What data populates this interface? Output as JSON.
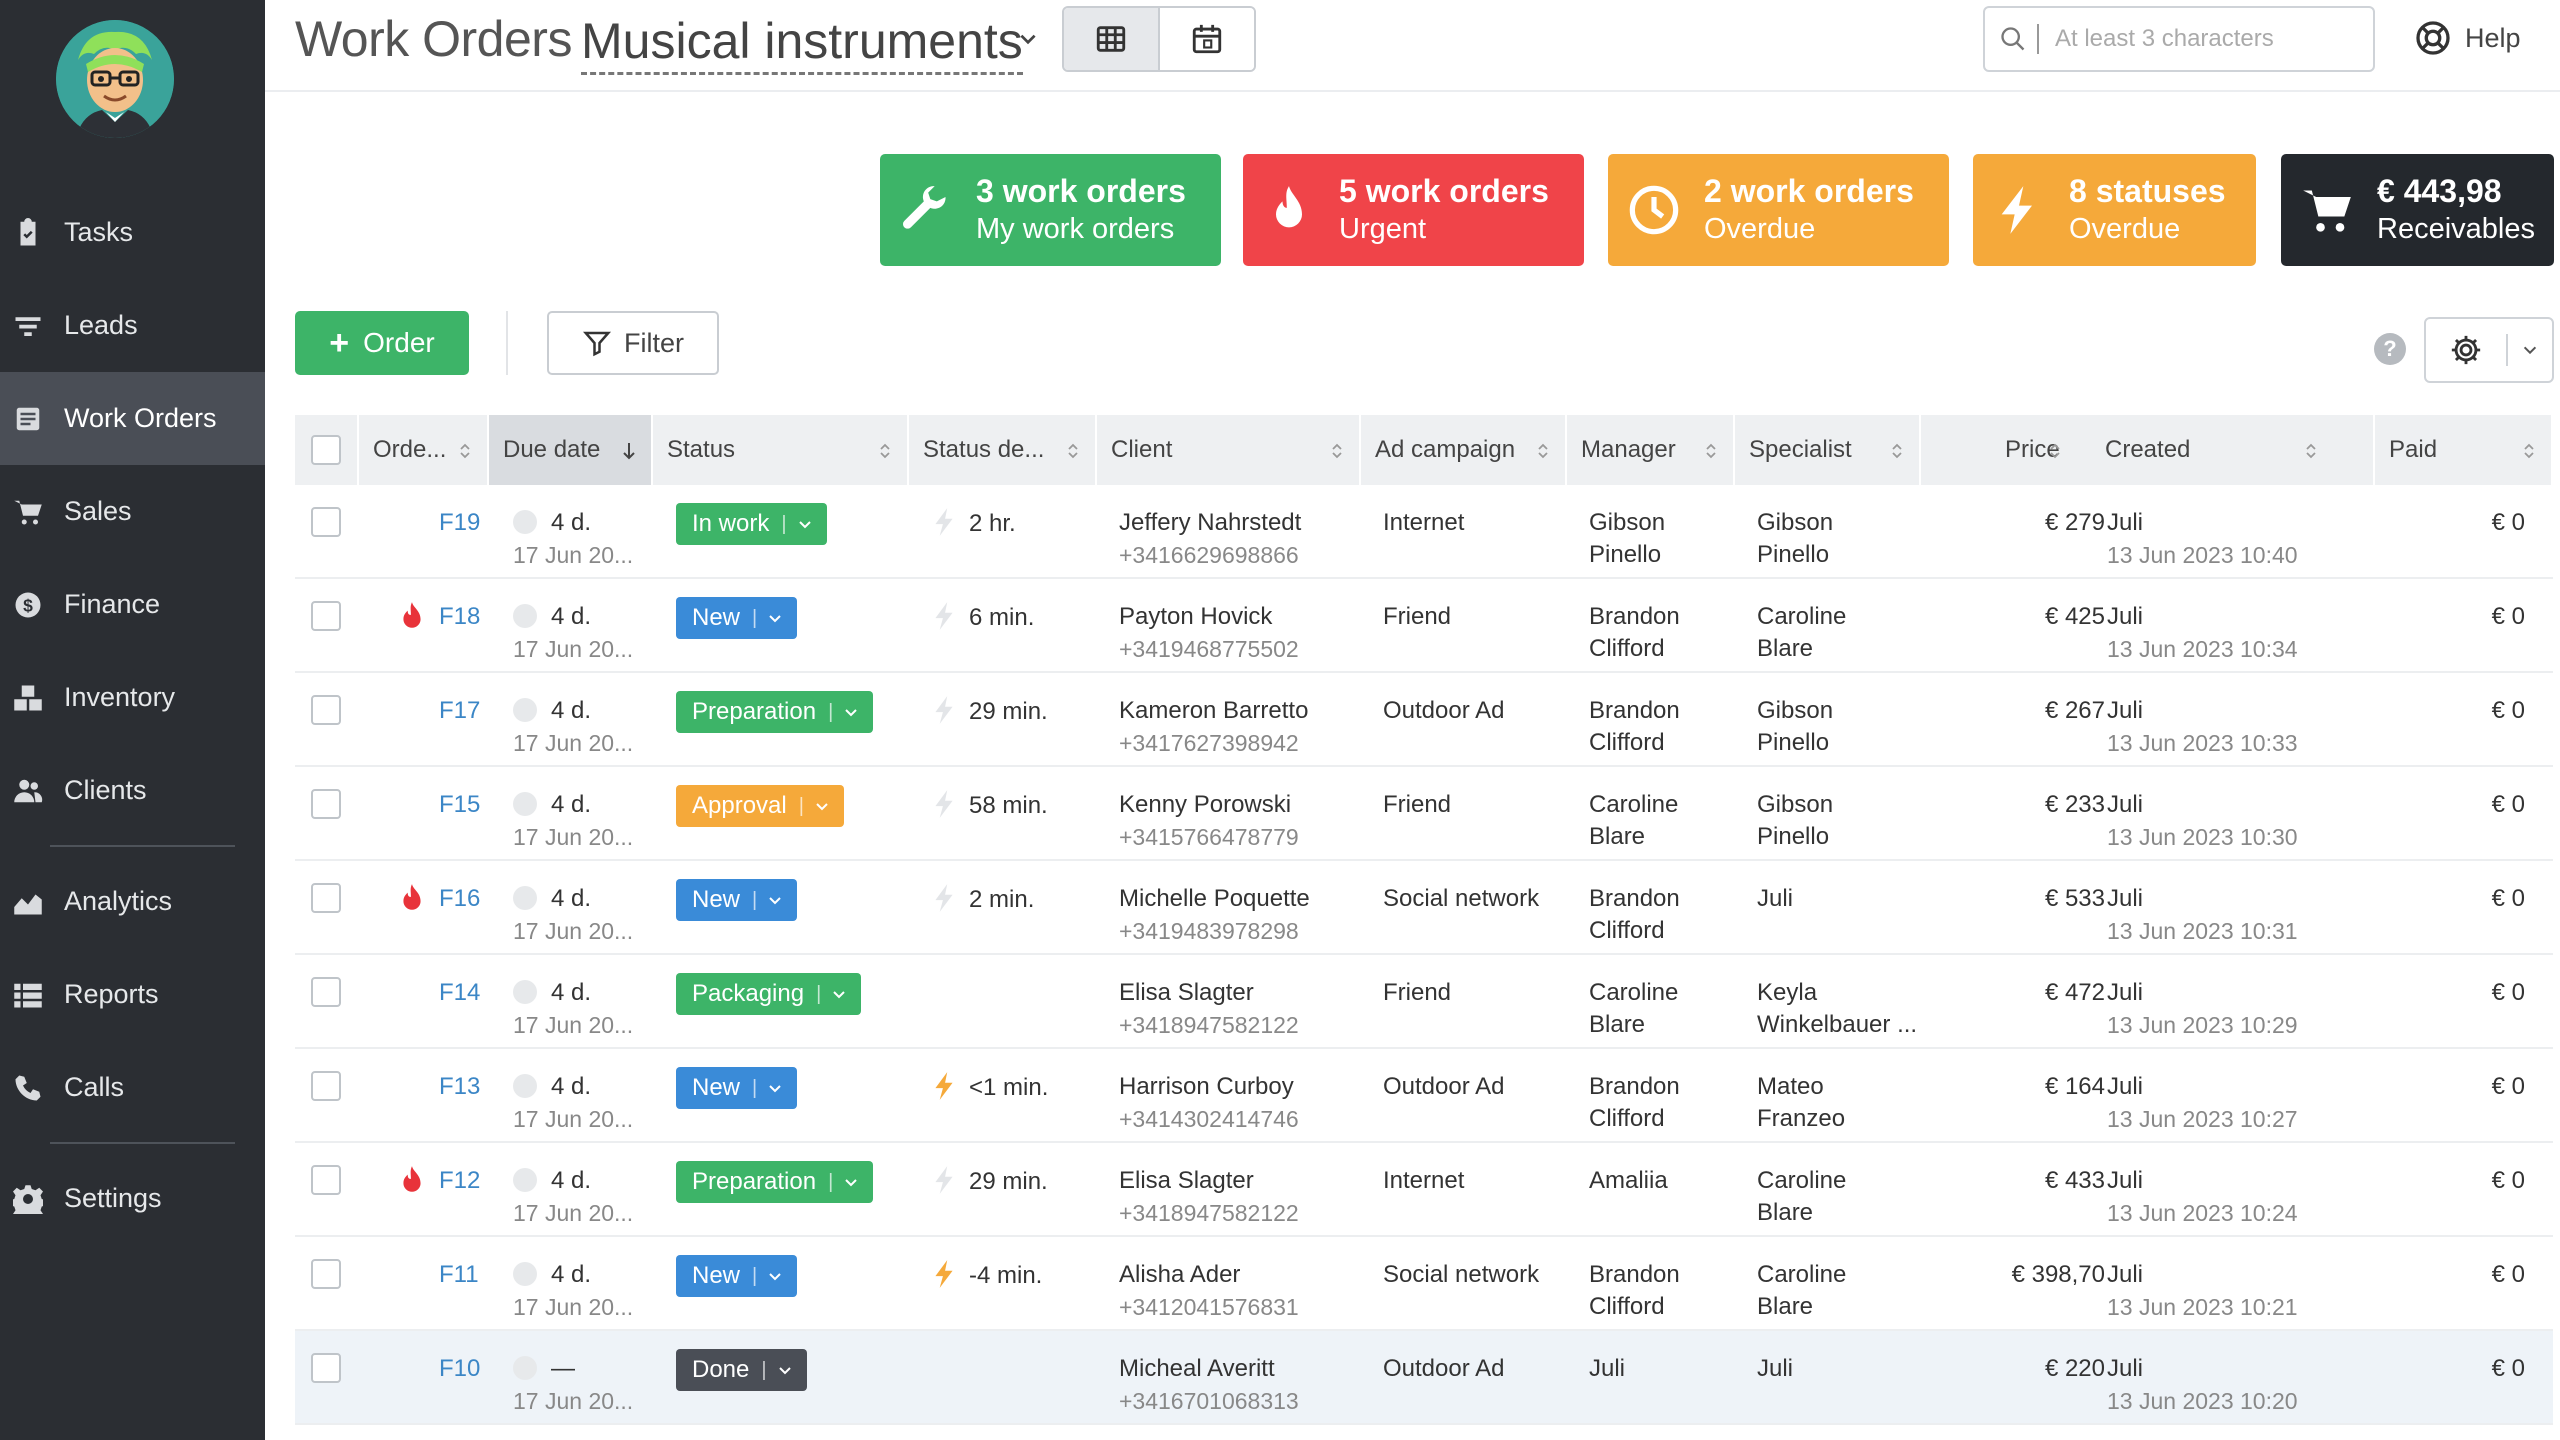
{
  "nav": {
    "items": [
      {
        "label": "Tasks",
        "icon": "clipboard-icon"
      },
      {
        "label": "Leads",
        "icon": "funnel-icon"
      },
      {
        "label": "Work Orders",
        "icon": "work-orders-icon"
      },
      {
        "label": "Sales",
        "icon": "cart-icon"
      },
      {
        "label": "Finance",
        "icon": "dollar-icon"
      },
      {
        "label": "Inventory",
        "icon": "boxes-icon"
      },
      {
        "label": "Clients",
        "icon": "users-icon"
      },
      {
        "label": "Analytics",
        "icon": "chart-icon"
      },
      {
        "label": "Reports",
        "icon": "list-icon"
      },
      {
        "label": "Calls",
        "icon": "phone-icon"
      },
      {
        "label": "Settings",
        "icon": "gear-icon"
      }
    ]
  },
  "header": {
    "title": "Work Orders",
    "project": "Musical instruments",
    "search_placeholder": "At least 3 characters",
    "help_label": "Help"
  },
  "cards": [
    {
      "main": "3 work orders",
      "sub": "My work orders",
      "color": "#3db468",
      "icon": "wrench-icon"
    },
    {
      "main": "5 work orders",
      "sub": "Urgent",
      "color": "#f04449",
      "icon": "fire-icon"
    },
    {
      "main": "2 work orders",
      "sub": "Overdue",
      "color": "#f5a93a",
      "icon": "clock-icon"
    },
    {
      "main": "8 statuses",
      "sub": "Overdue",
      "color": "#f5a93a",
      "icon": "bolt-icon"
    },
    {
      "main": "€ 443,98",
      "sub": "Receivables",
      "color": "#24282d",
      "icon": "cart-icon"
    }
  ],
  "toolbar": {
    "order_label": "Order",
    "filter_label": "Filter",
    "help_mark": "?"
  },
  "table": {
    "columns": [
      "Orde...",
      "Due date",
      "Status",
      "Status de...",
      "Client",
      "Ad campaign",
      "Manager",
      "Specialist",
      "Price",
      "Created",
      "Paid"
    ],
    "rows": [
      {
        "urgent": false,
        "id": "F19",
        "due": "4 d.",
        "due_date": "17 Jun 20...",
        "status": "In work",
        "status_color": "#3db468",
        "bolt": false,
        "status_dur": "2 hr.",
        "client": "Jeffery Nahrstedt",
        "phone": "+3416629698866",
        "ad": "Internet",
        "manager": [
          "Gibson",
          "Pinello"
        ],
        "specialist": [
          "Gibson",
          "Pinello"
        ],
        "price": "€ 279",
        "created_by": "Juli",
        "created_at": "13 Jun 2023 10:40",
        "paid": "€ 0"
      },
      {
        "urgent": true,
        "id": "F18",
        "due": "4 d.",
        "due_date": "17 Jun 20...",
        "status": "New",
        "status_color": "#3a8bd8",
        "bolt": false,
        "status_dur": "6 min.",
        "client": "Payton Hovick",
        "phone": "+3419468775502",
        "ad": "Friend",
        "manager": [
          "Brandon",
          "Clifford"
        ],
        "specialist": [
          "Caroline",
          "Blare"
        ],
        "price": "€ 425",
        "created_by": "Juli",
        "created_at": "13 Jun 2023 10:34",
        "paid": "€ 0"
      },
      {
        "urgent": false,
        "id": "F17",
        "due": "4 d.",
        "due_date": "17 Jun 20...",
        "status": "Preparation",
        "status_color": "#3db468",
        "bolt": false,
        "status_dur": "29 min.",
        "client": "Kameron Barretto",
        "phone": "+3417627398942",
        "ad": "Outdoor Ad",
        "manager": [
          "Brandon",
          "Clifford"
        ],
        "specialist": [
          "Gibson",
          "Pinello"
        ],
        "price": "€ 267",
        "created_by": "Juli",
        "created_at": "13 Jun 2023 10:33",
        "paid": "€ 0"
      },
      {
        "urgent": false,
        "id": "F15",
        "due": "4 d.",
        "due_date": "17 Jun 20...",
        "status": "Approval",
        "status_color": "#f5a93a",
        "bolt": false,
        "status_dur": "58 min.",
        "client": "Kenny Porowski",
        "phone": "+3415766478779",
        "ad": "Friend",
        "manager": [
          "Caroline",
          "Blare"
        ],
        "specialist": [
          "Gibson",
          "Pinello"
        ],
        "price": "€ 233",
        "created_by": "Juli",
        "created_at": "13 Jun 2023 10:30",
        "paid": "€ 0"
      },
      {
        "urgent": true,
        "id": "F16",
        "due": "4 d.",
        "due_date": "17 Jun 20...",
        "status": "New",
        "status_color": "#3a8bd8",
        "bolt": false,
        "status_dur": "2 min.",
        "client": "Michelle Poquette",
        "phone": "+3419483978298",
        "ad": "Social network",
        "manager": [
          "Brandon",
          "Clifford"
        ],
        "specialist": [
          "Juli",
          ""
        ],
        "price": "€ 533",
        "created_by": "Juli",
        "created_at": "13 Jun 2023 10:31",
        "paid": "€ 0"
      },
      {
        "urgent": false,
        "id": "F14",
        "due": "4 d.",
        "due_date": "17 Jun 20...",
        "status": "Packaging",
        "status_color": "#3db468",
        "bolt": null,
        "status_dur": "",
        "client": "Elisa Slagter",
        "phone": "+3418947582122",
        "ad": "Friend",
        "manager": [
          "Caroline",
          "Blare"
        ],
        "specialist": [
          "Keyla",
          "Winkelbauer ..."
        ],
        "price": "€ 472",
        "created_by": "Juli",
        "created_at": "13 Jun 2023 10:29",
        "paid": "€ 0"
      },
      {
        "urgent": false,
        "id": "F13",
        "due": "4 d.",
        "due_date": "17 Jun 20...",
        "status": "New",
        "status_color": "#3a8bd8",
        "bolt": true,
        "status_dur": "<1 min.",
        "client": "Harrison Curboy",
        "phone": "+3414302414746",
        "ad": "Outdoor Ad",
        "manager": [
          "Brandon",
          "Clifford"
        ],
        "specialist": [
          "Mateo",
          "Franzeo"
        ],
        "price": "€ 164",
        "created_by": "Juli",
        "created_at": "13 Jun 2023 10:27",
        "paid": "€ 0"
      },
      {
        "urgent": true,
        "id": "F12",
        "due": "4 d.",
        "due_date": "17 Jun 20...",
        "status": "Preparation",
        "status_color": "#3db468",
        "bolt": false,
        "status_dur": "29 min.",
        "client": "Elisa Slagter",
        "phone": "+3418947582122",
        "ad": "Internet",
        "manager": [
          "Amaliia",
          ""
        ],
        "specialist": [
          "Caroline",
          "Blare"
        ],
        "price": "€ 433",
        "created_by": "Juli",
        "created_at": "13 Jun 2023 10:24",
        "paid": "€ 0"
      },
      {
        "urgent": false,
        "id": "F11",
        "due": "4 d.",
        "due_date": "17 Jun 20...",
        "status": "New",
        "status_color": "#3a8bd8",
        "bolt": true,
        "status_dur": "-4 min.",
        "client": "Alisha Ader",
        "phone": "+3412041576831",
        "ad": "Social network",
        "manager": [
          "Brandon",
          "Clifford"
        ],
        "specialist": [
          "Caroline",
          "Blare"
        ],
        "price": "€ 398,70",
        "created_by": "Juli",
        "created_at": "13 Jun 2023 10:21",
        "paid": "€ 0"
      },
      {
        "urgent": false,
        "id": "F10",
        "due": "—",
        "due_date": "17 Jun 20...",
        "status": "Done",
        "status_color": "#4a4e56",
        "bolt": null,
        "status_dur": "",
        "client": "Micheal Averitt",
        "phone": "+3416701068313",
        "ad": "Outdoor Ad",
        "manager": [
          "Juli",
          ""
        ],
        "specialist": [
          "Juli",
          ""
        ],
        "price": "€ 220",
        "created_by": "Juli",
        "created_at": "13 Jun 2023 10:20",
        "paid": "€ 0",
        "highlight": true
      }
    ]
  }
}
